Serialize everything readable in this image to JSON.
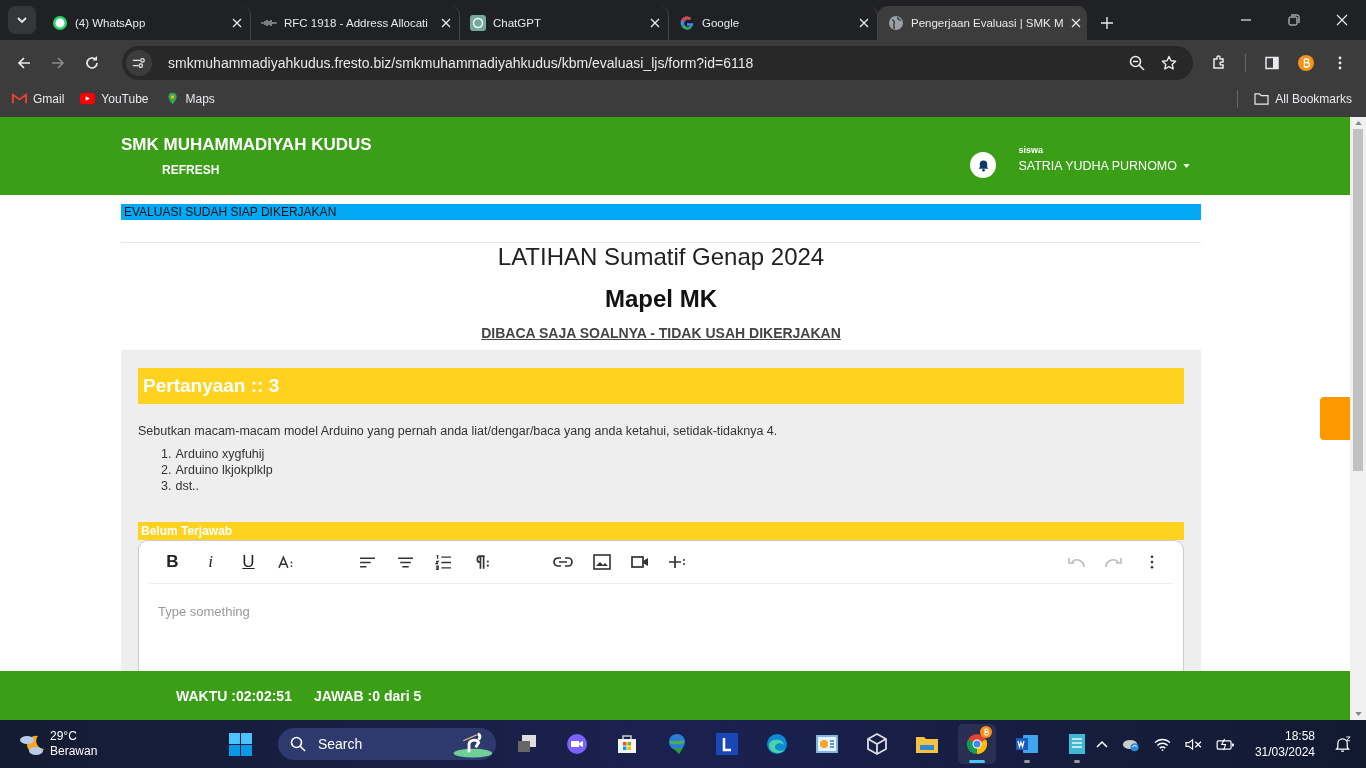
{
  "browser": {
    "tabs": [
      {
        "title": "(4) WhatsApp",
        "selected": false
      },
      {
        "title": "RFC 1918 - Address Allocati",
        "selected": false
      },
      {
        "title": "ChatGPT",
        "selected": false
      },
      {
        "title": "Google",
        "selected": false
      },
      {
        "title": "Pengerjaan Evaluasi | SMK M",
        "selected": true
      }
    ],
    "address": "smkmuhammadiyahkudus.fresto.biz/smkmuhammadiyahkudus/kbm/evaluasi_ljs/form?id=6118",
    "bookmarks": [
      "Gmail",
      "YouTube",
      "Maps"
    ],
    "all_bookmarks": "All Bookmarks"
  },
  "header": {
    "school": "SMK MUHAMMADIYAH KUDUS",
    "refresh": "REFRESH",
    "role": "siswa",
    "user": "SATRIA YUDHA PURNOMO"
  },
  "notice": "EVALUASI SUDAH SIAP DIKERJAKAN",
  "exam": {
    "title": "LATIHAN Sumatif Genap 2024",
    "subject": "Mapel MK",
    "instruction": "DIBACA SAJA SOALNYA - TIDAK USAH DIKERJAKAN"
  },
  "question": {
    "heading": "Pertanyaan :: 3",
    "text": "Sebutkan macam-macam model Arduino yang pernah anda liat/dengar/baca yang anda ketahui, setidak-tidaknya 4.",
    "items": [
      {
        "number": "1.",
        "text": "Arduino xygfuhij"
      },
      {
        "number": "2.",
        "text": "Arduino lkjokplklp"
      },
      {
        "number": "3.",
        "text": "dst.."
      }
    ],
    "status": "Belum Terjawab"
  },
  "editor": {
    "format_buttons": [
      "B",
      "i",
      "U"
    ],
    "undo_disabled": true,
    "redo_disabled": true,
    "placeholder": "Type something"
  },
  "footer": {
    "time": "WAKTU :02:02:51",
    "answered": "JAWAB :0 dari 5"
  },
  "taskbar": {
    "temperature": "29°C",
    "weather": "Berawan",
    "search": "Search",
    "apps": [
      {
        "running": false,
        "selected": false
      },
      {
        "running": false,
        "selected": false
      },
      {
        "running": false,
        "selected": false
      },
      {
        "running": false,
        "selected": false
      },
      {
        "running": false,
        "selected": false
      },
      {
        "running": false,
        "selected": false
      },
      {
        "running": false,
        "selected": false
      },
      {
        "running": false,
        "selected": false
      },
      {
        "running": false,
        "selected": false
      },
      {
        "running": true,
        "selected": true
      },
      {
        "running": true,
        "selected": false
      },
      {
        "running": true,
        "selected": false
      }
    ],
    "time": "18:58",
    "date": "31/03/2024"
  }
}
